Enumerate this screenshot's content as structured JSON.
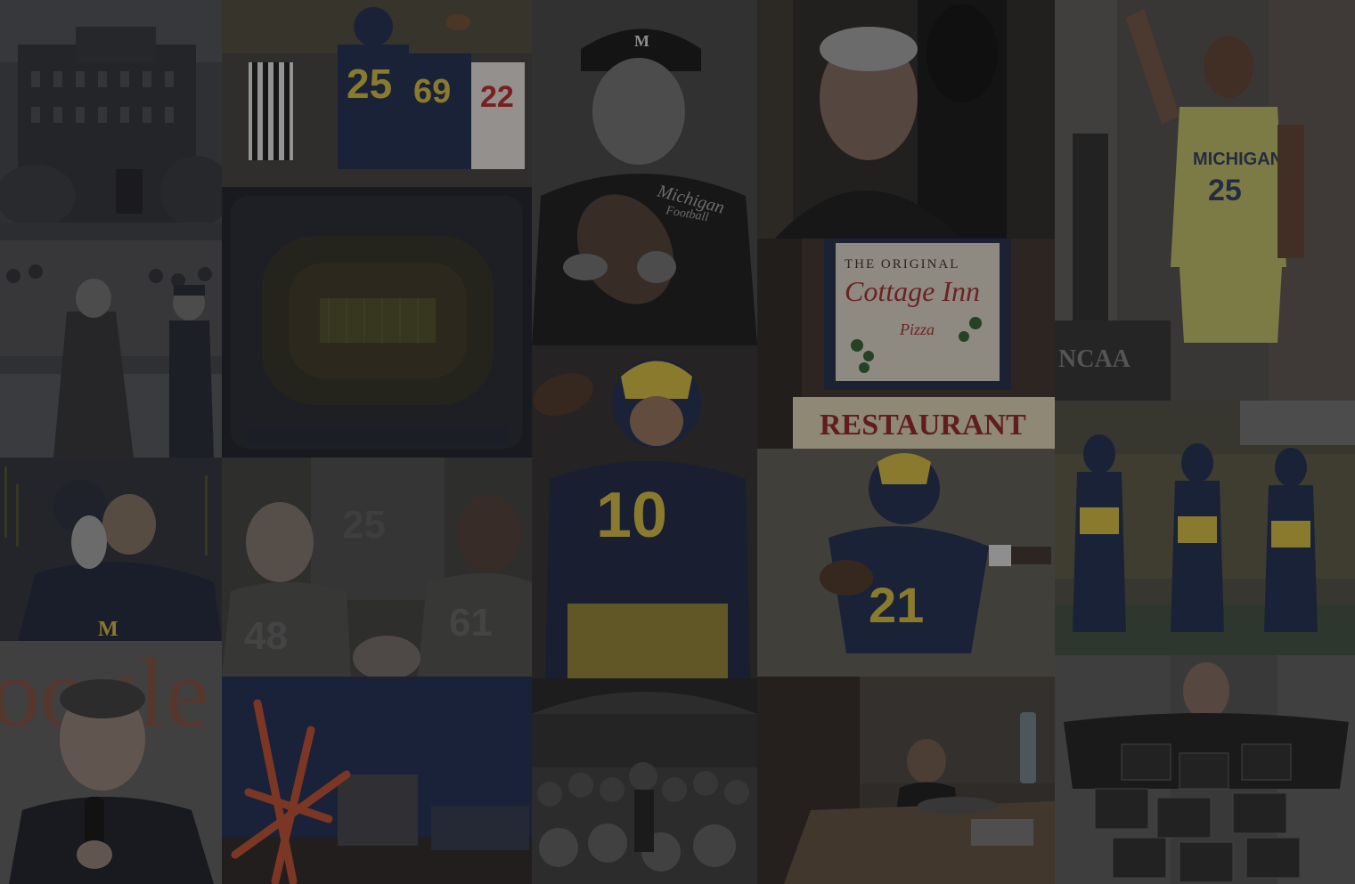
{
  "tiles": {
    "building": {
      "icon": "campus-building-photo"
    },
    "football_25_69": {
      "jersey_a": "25",
      "jersey_b": "69",
      "jersey_c": "22",
      "icon": "football-celebration-photo"
    },
    "coach": {
      "cap": "M",
      "jacket": "Michigan",
      "jacket_sub": "Football",
      "icon": "coach-portrait-photo"
    },
    "man_portrait": {
      "icon": "man-portrait-photo"
    },
    "basketball": {
      "jersey_name": "MICHIGAN",
      "jersey_num": "25",
      "banner": "NCAA",
      "icon": "basketball-player-photo"
    },
    "parade": {
      "icon": "parade-photo"
    },
    "stadium": {
      "icon": "stadium-aerial-photo"
    },
    "cottage_inn": {
      "line1": "THE ORIGINAL",
      "line2": "Cottage Inn",
      "line3": "Pizza",
      "line4": "RESTAURANT",
      "icon": "restaurant-sign-photo"
    },
    "helmet_lift": {
      "icon": "player-helmet-photo"
    },
    "three_players": {
      "num_a": "25",
      "num_b": "48",
      "num_c": "61",
      "icon": "team-portrait-photo"
    },
    "quarterback": {
      "jersey": "10",
      "icon": "quarterback-photo"
    },
    "runner": {
      "jersey": "21",
      "icon": "running-back-photo"
    },
    "band": {
      "icon": "marching-band-photo"
    },
    "speaker": {
      "icon": "speaker-portrait-photo"
    },
    "sculpture": {
      "icon": "sculpture-night-photo"
    },
    "crowd_speech": {
      "icon": "crowd-speech-photo"
    },
    "child_table": {
      "icon": "child-at-table-photo"
    },
    "woman_laptops": {
      "icon": "woman-laptops-photo"
    }
  },
  "colors": {
    "maize": "#c9b13a",
    "blue": "#1e2a4a",
    "overlay": "#141418"
  }
}
